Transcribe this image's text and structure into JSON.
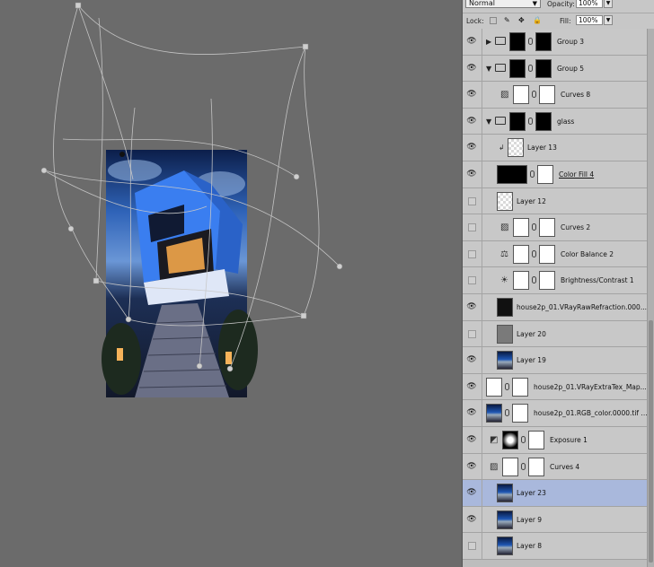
{
  "panel": {
    "blend_mode": "Normal",
    "opacity_label": "Opacity:",
    "opacity_value": "100%",
    "lock_label": "Lock:",
    "fill_label": "Fill:",
    "fill_value": "100%"
  },
  "layers": [
    {
      "name": "Group 3",
      "visible": true,
      "kind": "group-collapsed",
      "thumb": "black-mask"
    },
    {
      "name": "Group 5",
      "visible": true,
      "kind": "group-open",
      "thumb": "black-mask"
    },
    {
      "name": "Curves 8",
      "visible": true,
      "kind": "curves",
      "thumb": "white"
    },
    {
      "name": "glass",
      "visible": true,
      "kind": "group-open",
      "thumb": "black-mask"
    },
    {
      "name": "Layer 13",
      "visible": true,
      "kind": "clipped-pixel",
      "thumb": "checker"
    },
    {
      "name": "Color Fill 4",
      "visible": true,
      "kind": "fill",
      "thumb": "black"
    },
    {
      "name": "Layer 12",
      "visible": false,
      "kind": "pixel",
      "thumb": "checker"
    },
    {
      "name": "Curves 2",
      "visible": false,
      "kind": "curves",
      "thumb": "white"
    },
    {
      "name": "Color Balance 2",
      "visible": false,
      "kind": "color-balance",
      "thumb": "white"
    },
    {
      "name": "Brightness/Contrast 1",
      "visible": false,
      "kind": "brightness",
      "thumb": "white"
    },
    {
      "name": "house2p_01.VRayRawRefraction.000...",
      "visible": true,
      "kind": "pixel",
      "thumb": "dark"
    },
    {
      "name": "Layer 20",
      "visible": false,
      "kind": "pixel",
      "thumb": "gray"
    },
    {
      "name": "Layer 19",
      "visible": true,
      "kind": "pixel",
      "thumb": "blue"
    },
    {
      "name": "house2p_01.VRayExtraTex_Map...",
      "visible": true,
      "kind": "masked-pixel",
      "thumb": "white"
    },
    {
      "name": "house2p_01.RGB_color.0000.tif ...",
      "visible": true,
      "kind": "masked-pixel",
      "thumb": "blue"
    },
    {
      "name": "Exposure 1",
      "visible": true,
      "kind": "exposure",
      "thumb": "exposure"
    },
    {
      "name": "Curves 4",
      "visible": true,
      "kind": "curves",
      "thumb": "white"
    },
    {
      "name": "Layer 23",
      "visible": true,
      "kind": "pixel",
      "thumb": "blue",
      "selected": true
    },
    {
      "name": "Layer 9",
      "visible": true,
      "kind": "pixel",
      "thumb": "blue"
    },
    {
      "name": "Layer 8",
      "visible": false,
      "kind": "pixel",
      "thumb": "blue"
    }
  ]
}
